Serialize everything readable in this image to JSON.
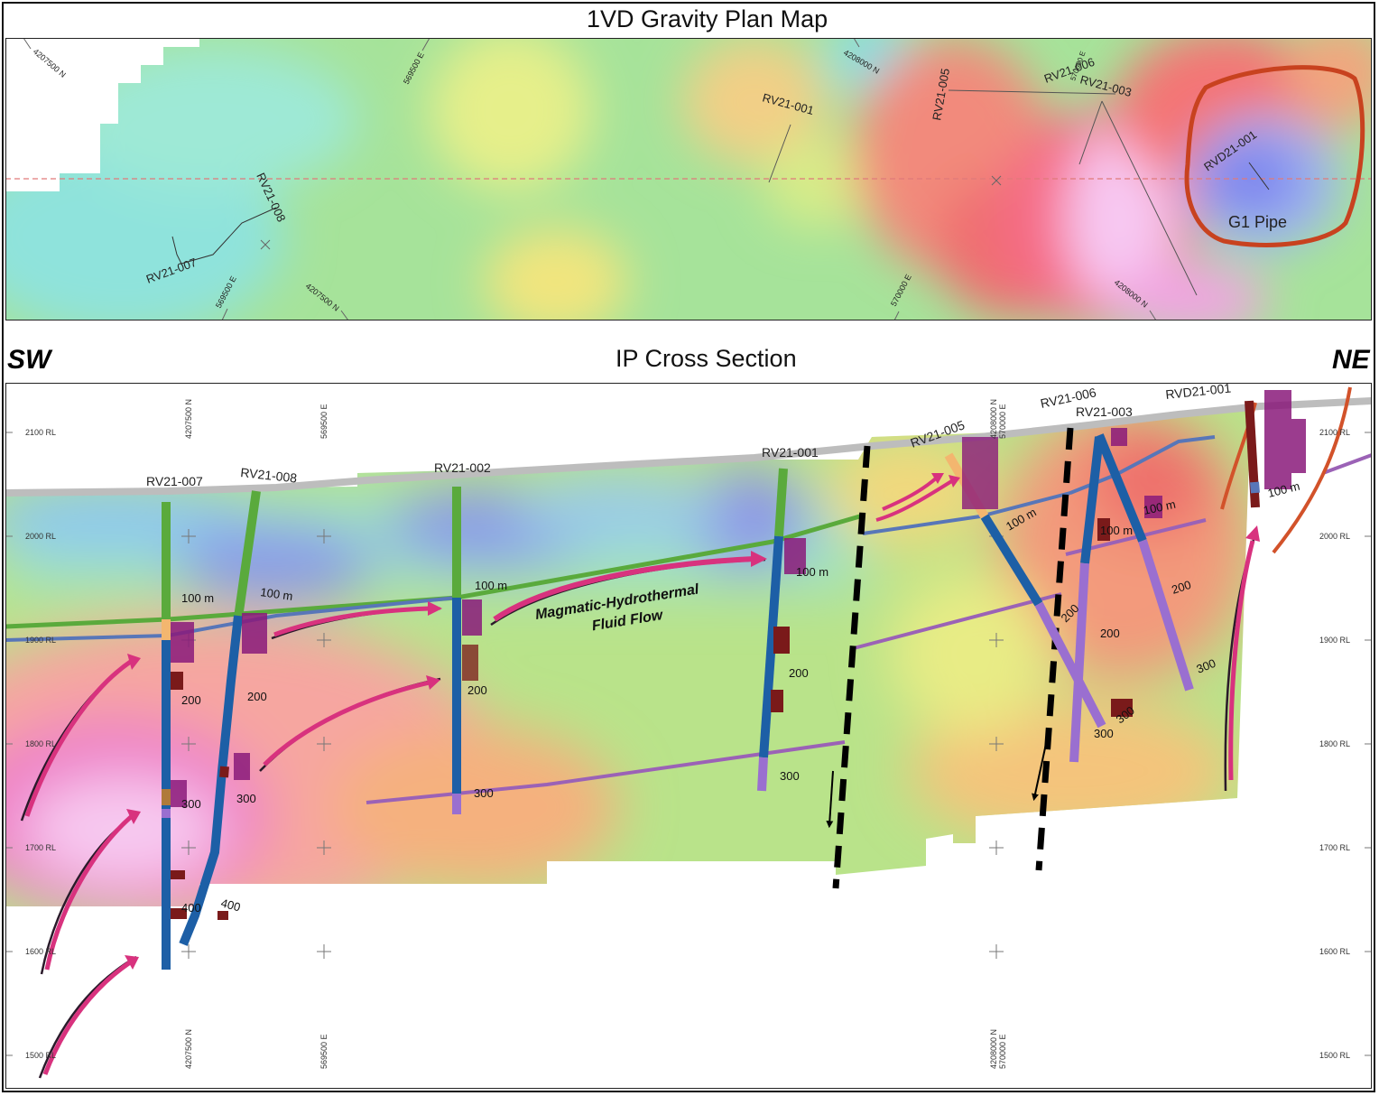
{
  "titles": {
    "plan": "1VD Gravity Plan Map",
    "section": "IP Cross Section"
  },
  "orientation": {
    "left": "SW",
    "right": "NE"
  },
  "plan_map": {
    "colors": {
      "low": "#7f86ee",
      "mid": "#9fe08e",
      "high": "#ef5f6f",
      "very_high": "#f7c9f3",
      "pipe_outline": "#c8421f"
    },
    "pipe_label": "G1 Pipe",
    "holes": [
      "RV21-007",
      "RV21-008",
      "RV21-001",
      "RV21-005",
      "RV21-006",
      "RV21-003",
      "RVD21-001"
    ],
    "grid_labels": [
      "4207500 N",
      "569500 E",
      "4208000 N",
      "569500 E",
      "4207500 N",
      "570000 E",
      "4208000 N",
      "570000 E"
    ]
  },
  "section": {
    "rl_labels": [
      "2100 RL",
      "2000 RL",
      "1900 RL",
      "1800 RL",
      "1700 RL",
      "1600 RL",
      "1500 RL"
    ],
    "grid_top": [
      "4207500 N",
      "569500 E",
      "4208000 N",
      "570000 E"
    ],
    "grid_bottom": [
      "4207500 N",
      "569500 E",
      "4208000 N",
      "570000 E"
    ],
    "holes": [
      "RV21-007",
      "RV21-008",
      "RV21-002",
      "RV21-001",
      "RV21-005",
      "RV21-006",
      "RV21-003",
      "RVD21-001"
    ],
    "depth_labels": [
      "100 m",
      "100 m",
      "100 m",
      "100 m",
      "100 m",
      "100 m",
      "100 m",
      "100 m",
      "200",
      "200",
      "200",
      "200",
      "200",
      "200",
      "200",
      "300",
      "300",
      "300",
      "300",
      "300",
      "300",
      "300",
      "400",
      "400"
    ],
    "flow_label_line1": "Magmatic-Hydrothermal",
    "flow_label_line2": "Fluid Flow",
    "colors": {
      "arrow": "#d8327e",
      "fault": "#000000",
      "green_horizon": "#5aaa3c",
      "blue_horizon": "#5876b8",
      "purple_horizon": "#9b62b6",
      "pipe_outline": "#d2522a"
    }
  }
}
